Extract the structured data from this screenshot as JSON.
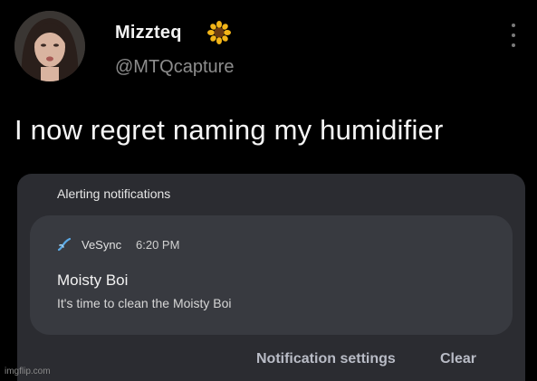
{
  "tweet": {
    "display_name": "Mizzteq",
    "badge_icon": "sunflower-icon",
    "handle": "@MTQcapture",
    "text": "I now regret naming my humidifier"
  },
  "notification_panel": {
    "title": "Alerting notifications",
    "notification": {
      "app_icon": "vesync-icon",
      "app_name": "VeSync",
      "time": "6:20 PM",
      "title": "Moisty Boi",
      "body": "It's time to clean the Moisty Boi"
    },
    "actions": {
      "settings_label": "Notification settings",
      "clear_label": "Clear"
    }
  },
  "watermark": "imgflip.com",
  "colors": {
    "background": "#000000",
    "panel": "#2b2c31",
    "card": "#383a40",
    "handle": "#8d8d8d",
    "action": "#b9bcc6"
  }
}
